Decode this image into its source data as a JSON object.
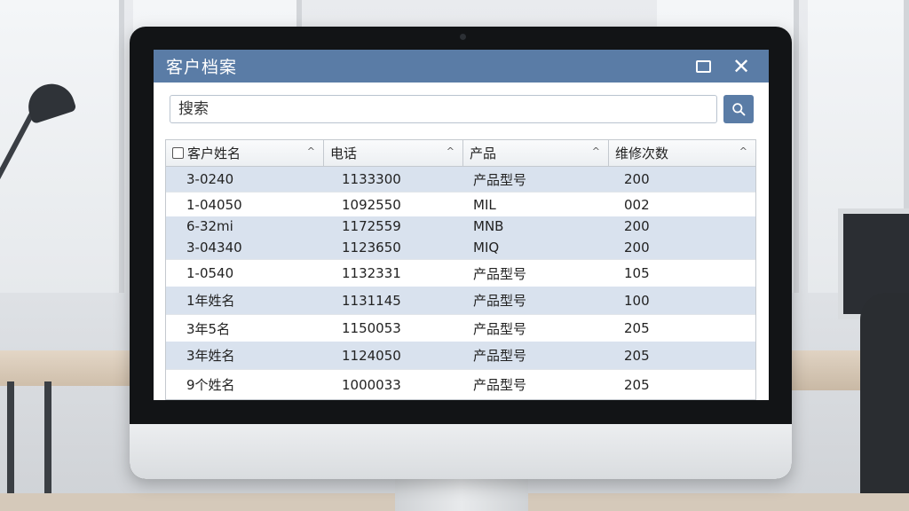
{
  "window": {
    "title": "客户档案"
  },
  "search": {
    "placeholder": "搜索"
  },
  "table": {
    "columns": [
      "客户姓名",
      "电话",
      "产品",
      "维修次数"
    ],
    "rows": [
      [
        "3-0240",
        "1133300",
        "产品型号",
        "200"
      ],
      [
        "1-04050",
        "1092550",
        "MIL",
        "002"
      ],
      [
        "6-32mi",
        "1172559",
        "MNB",
        "200"
      ],
      [
        "3-04340",
        "1123650",
        "MIQ",
        "200"
      ],
      [
        "1-0540",
        "1132331",
        "产品型号",
        "105"
      ],
      [
        "1年姓名",
        "1131145",
        "产品型号",
        "100"
      ],
      [
        "3年5名",
        "1150053",
        "产品型号",
        "205"
      ],
      [
        "3年姓名",
        "1124050",
        "产品型号",
        "205"
      ],
      [
        "9个姓名",
        "1000033",
        "产品型号",
        "205"
      ]
    ]
  },
  "colors": {
    "accent": "#5a7ca6",
    "row_alt": "#d9e2ee"
  },
  "icons": {
    "maximize": "maximize-icon",
    "close": "close-icon",
    "search": "search-icon",
    "sort": "chevron-up-icon",
    "checkbox": "checkbox-icon"
  }
}
